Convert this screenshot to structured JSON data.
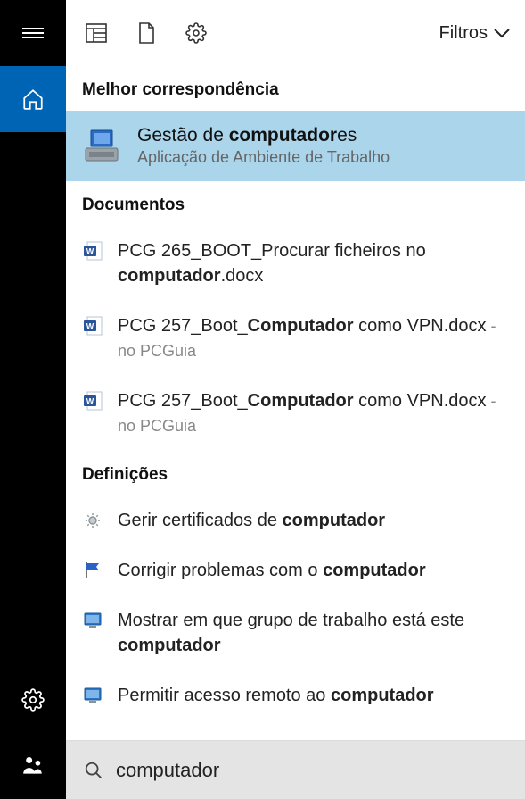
{
  "sidebar": {
    "items": [
      "menu",
      "home",
      "settings",
      "feedback"
    ]
  },
  "toolbar": {
    "filters_label": "Filtros"
  },
  "sections": {
    "best_match": "Melhor correspondência",
    "documents": "Documentos",
    "settings": "Definições"
  },
  "best": {
    "title_pre": "Gestão de ",
    "title_bold": "computador",
    "title_post": "es",
    "subtitle": "Aplicação de Ambiente de Trabalho"
  },
  "documents": [
    {
      "pre": "PCG 265_BOOT_Procurar ficheiros no ",
      "bold": "computador",
      "post": ".docx",
      "location": ""
    },
    {
      "pre": "PCG 257_Boot_",
      "bold": "Computador",
      "post": " como VPN.docx",
      "location": " - no PCGuia"
    },
    {
      "pre": "PCG 257_Boot_",
      "bold": "Computador",
      "post": " como VPN.docx",
      "location": " - no PCGuia"
    }
  ],
  "settings_items": [
    {
      "pre": "Gerir certificados de ",
      "bold": "computador",
      "post": "",
      "icon": "cert"
    },
    {
      "pre": "Corrigir problemas com o ",
      "bold": "computador",
      "post": "",
      "icon": "flag"
    },
    {
      "pre": "Mostrar em que grupo de trabalho está este ",
      "bold": "computador",
      "post": "",
      "icon": "monitor"
    },
    {
      "pre": "Permitir acesso remoto ao ",
      "bold": "computador",
      "post": "",
      "icon": "monitor"
    }
  ],
  "search": {
    "value": "computador"
  }
}
